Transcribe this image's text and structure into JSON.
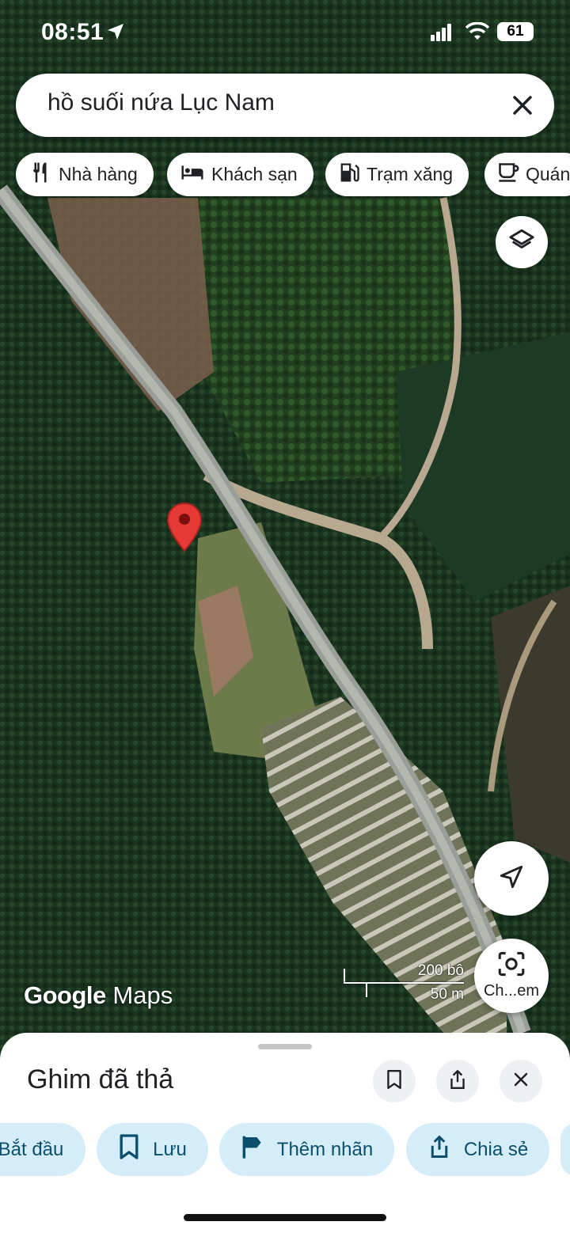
{
  "status_bar": {
    "time": "08:51",
    "battery": "61"
  },
  "search": {
    "query": "hồ suối nứa Lục Nam"
  },
  "chips": [
    {
      "label": "Nhà hàng",
      "icon": "restaurant-icon"
    },
    {
      "label": "Khách sạn",
      "icon": "hotel-icon"
    },
    {
      "label": "Trạm xăng",
      "icon": "gas-station-icon"
    },
    {
      "label": "Quán",
      "icon": "coffee-icon"
    }
  ],
  "map": {
    "brand_google": "Google",
    "brand_maps": "Maps",
    "scale_imperial": "200 bộ",
    "scale_metric": "50 m",
    "lens_label": "Ch...em"
  },
  "sheet": {
    "title": "Ghim đã thả",
    "actions": [
      {
        "label": "Bắt đầu",
        "icon": "navigate-icon"
      },
      {
        "label": "Lưu",
        "icon": "bookmark-icon"
      },
      {
        "label": "Thêm nhãn",
        "icon": "flag-icon"
      },
      {
        "label": "Chia sẻ",
        "icon": "share-icon"
      }
    ]
  },
  "colors": {
    "pin": "#e53935",
    "action_bg": "#d4edf8",
    "action_text": "#0b4f6c",
    "road": "#9a9e98"
  }
}
